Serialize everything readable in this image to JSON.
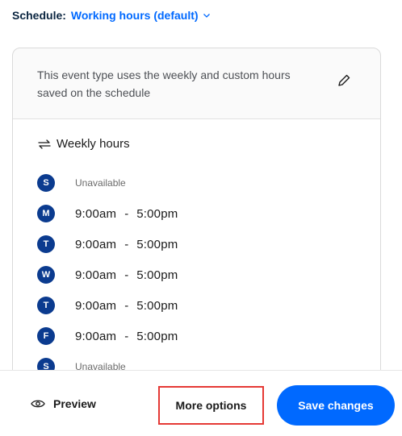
{
  "schedule": {
    "label": "Schedule:",
    "value": "Working hours (default)",
    "icon": "chevron-down-icon"
  },
  "card": {
    "description": "This event type uses the weekly and custom hours saved on the schedule",
    "edit_icon": "pencil-icon"
  },
  "weekly": {
    "title": "Weekly hours",
    "icon": "repeat-icon",
    "days": [
      {
        "letter": "S",
        "unavailable": "Unavailable"
      },
      {
        "letter": "M",
        "start": "9:00am",
        "sep": "-",
        "end": "5:00pm"
      },
      {
        "letter": "T",
        "start": "9:00am",
        "sep": "-",
        "end": "5:00pm"
      },
      {
        "letter": "W",
        "start": "9:00am",
        "sep": "-",
        "end": "5:00pm"
      },
      {
        "letter": "T",
        "start": "9:00am",
        "sep": "-",
        "end": "5:00pm"
      },
      {
        "letter": "F",
        "start": "9:00am",
        "sep": "-",
        "end": "5:00pm"
      },
      {
        "letter": "S",
        "unavailable": "Unavailable"
      }
    ]
  },
  "footer": {
    "preview_label": "Preview",
    "preview_icon": "eye-icon",
    "more_label": "More options",
    "save_label": "Save changes"
  },
  "colors": {
    "accent": "#0069ff",
    "badge": "#0b3b8f",
    "highlight_border": "#e53935"
  }
}
